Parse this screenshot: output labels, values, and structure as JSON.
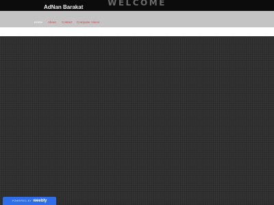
{
  "header": {
    "banner_text": "WELCOME",
    "site_title": "AdNan Barakat"
  },
  "nav": {
    "items": [
      {
        "label": "Home",
        "active": true
      },
      {
        "label": "About",
        "active": false
      },
      {
        "label": "Contact",
        "active": false
      },
      {
        "label": "Computer Vision",
        "active": false
      }
    ]
  },
  "footer_badge": {
    "powered_by": "POWERED BY",
    "brand": "weebly"
  },
  "colors": {
    "header_bg": "#0c0c0c",
    "nav_bg": "#c4c4c4",
    "content_bg": "#2c2c2c",
    "nav_active": "#ffffff",
    "nav_link": "#d14b4b",
    "badge_bg": "#2f6ee6"
  }
}
